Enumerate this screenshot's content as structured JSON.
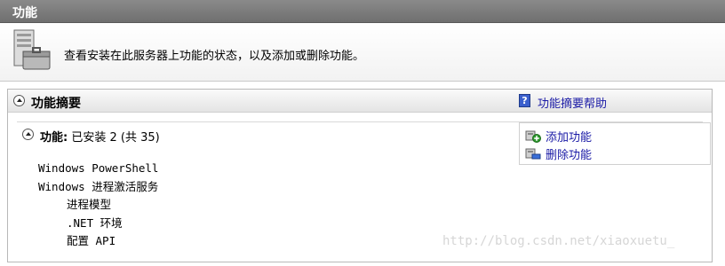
{
  "title_bar": {
    "title": "功能"
  },
  "description": {
    "icon": "server-toolbox-icon",
    "text": "查看安装在此服务器上功能的状态，以及添加或删除功能。"
  },
  "summary": {
    "title": "功能摘要",
    "help_icon": "help-icon",
    "help_link": "功能摘要帮助",
    "features": {
      "label": "功能:",
      "status": "已安装 2 (共 35)",
      "items": [
        {
          "label": "Windows PowerShell",
          "level": 0
        },
        {
          "label": "Windows 进程激活服务",
          "level": 0
        },
        {
          "label": "进程模型",
          "level": 1
        },
        {
          "label": ".NET 环境",
          "level": 1
        },
        {
          "label": "配置 API",
          "level": 1
        }
      ]
    },
    "actions": [
      {
        "label": "添加功能",
        "icon": "add-feature-icon"
      },
      {
        "label": "删除功能",
        "icon": "remove-feature-icon"
      }
    ]
  },
  "watermark": "http://blog.csdn.net/xiaoxuetu_",
  "colors": {
    "title_bar": "#7a7a7a",
    "link": "#1a1aa6",
    "help_icon": "#3a5fcd"
  }
}
